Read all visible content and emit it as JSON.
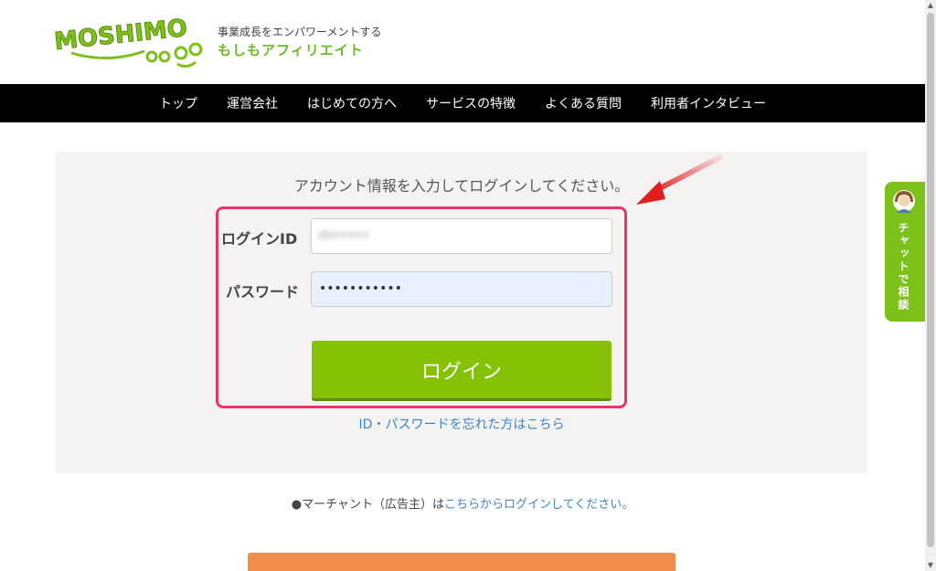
{
  "header": {
    "logo_text": "MOSHIMO",
    "tagline": "事業成長をエンパワーメントする",
    "brand_name": "もしもアフィリエイト"
  },
  "nav": {
    "items": [
      "トップ",
      "運営会社",
      "はじめての方へ",
      "サービスの特徴",
      "よくある質問",
      "利用者インタビュー"
    ]
  },
  "login": {
    "instruction": "アカウント情報を入力してログインしてください。",
    "id_label": "ログインID",
    "id_value": "m•••••",
    "password_label": "パスワード",
    "password_value": "•••••••••••",
    "button_label": "ログイン",
    "forgot_link": "ID・パスワードを忘れた方はこちら"
  },
  "merchant": {
    "prefix": "●マーチャント（広告主）は",
    "link": "こちらからログインしてください。"
  },
  "chat_tab": {
    "label": "チャットで相談"
  },
  "colors": {
    "accent_green": "#86c106",
    "highlight_pink": "#e8366a",
    "link_blue": "#3a87c8",
    "arrow_red": "#e02020"
  }
}
